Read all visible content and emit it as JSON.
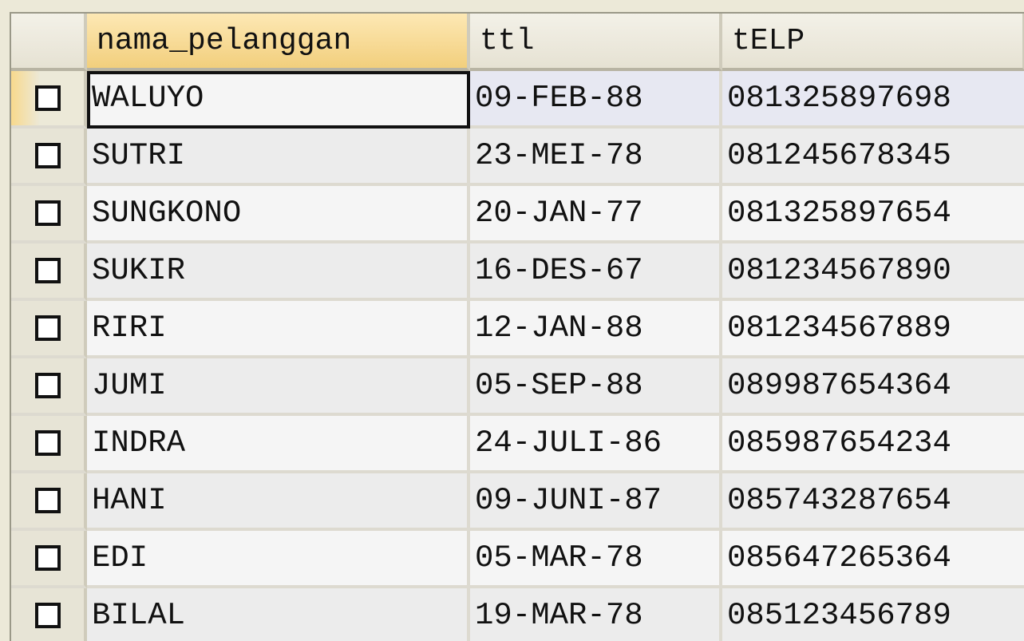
{
  "columns": [
    "nama_pelanggan",
    "ttl",
    "tELP"
  ],
  "rows": [
    {
      "nama_pelanggan": "WALUYO",
      "ttl": "09-FEB-88",
      "telp": "081325897698"
    },
    {
      "nama_pelanggan": "SUTRI",
      "ttl": "23-MEI-78",
      "telp": "081245678345"
    },
    {
      "nama_pelanggan": "SUNGKONO",
      "ttl": "20-JAN-77",
      "telp": "081325897654"
    },
    {
      "nama_pelanggan": "SUKIR",
      "ttl": "16-DES-67",
      "telp": "081234567890"
    },
    {
      "nama_pelanggan": "RIRI",
      "ttl": "12-JAN-88",
      "telp": "081234567889"
    },
    {
      "nama_pelanggan": "JUMI",
      "ttl": "05-SEP-88",
      "telp": "089987654364"
    },
    {
      "nama_pelanggan": "INDRA",
      "ttl": "24-JULI-86",
      "telp": "085987654234"
    },
    {
      "nama_pelanggan": "HANI",
      "ttl": "09-JUNI-87",
      "telp": "085743287654"
    },
    {
      "nama_pelanggan": "EDI",
      "ttl": "05-MAR-78",
      "telp": "085647265364"
    },
    {
      "nama_pelanggan": "BILAL",
      "ttl": "19-MAR-78",
      "telp": "085123456789"
    }
  ],
  "icons": {
    "row_selector": "checkbox-icon"
  },
  "colors": {
    "sorted_header": "#f2cf7d",
    "selection": "#e7e8f2"
  }
}
